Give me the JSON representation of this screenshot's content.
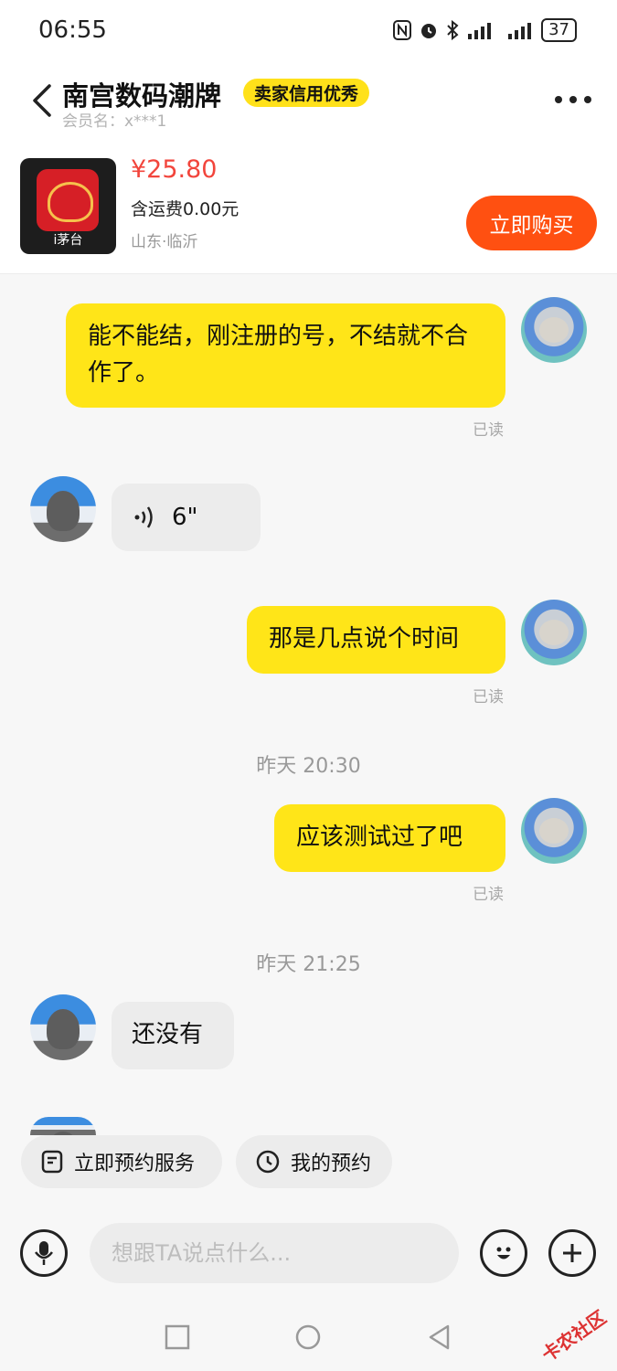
{
  "status_bar": {
    "time": "06:55",
    "battery": "37",
    "signal_text": "ull ull"
  },
  "header": {
    "shop_name": "南宫数码潮牌",
    "credit_badge": "卖家信用优秀",
    "member": "会员名：x***1"
  },
  "product": {
    "thumb_label": "i茅台",
    "price": "¥25.80",
    "shipping": "含运费0.00元",
    "location": "山东·临沂",
    "buy_label": "立即购买"
  },
  "chat": {
    "m1": {
      "text": "能不能结，刚注册的号，不结就不合作了。",
      "status": "已读"
    },
    "m2": {
      "duration": "6\""
    },
    "m3": {
      "text": "那是几点说个时间",
      "status": "已读"
    },
    "t1": "昨天 20:30",
    "m4": {
      "text": "应该测试过了吧",
      "status": "已读"
    },
    "t2": "昨天 21:25",
    "m5": {
      "text": "还没有"
    }
  },
  "quick_actions": {
    "book": "立即预约服务",
    "my_booking": "我的预约"
  },
  "input": {
    "placeholder": "想跟TA说点什么..."
  },
  "watermark": "卡农社区",
  "colors": {
    "accent_yellow": "#ffe518",
    "buy_orange": "#ff5011",
    "price_red": "#f2453c"
  }
}
